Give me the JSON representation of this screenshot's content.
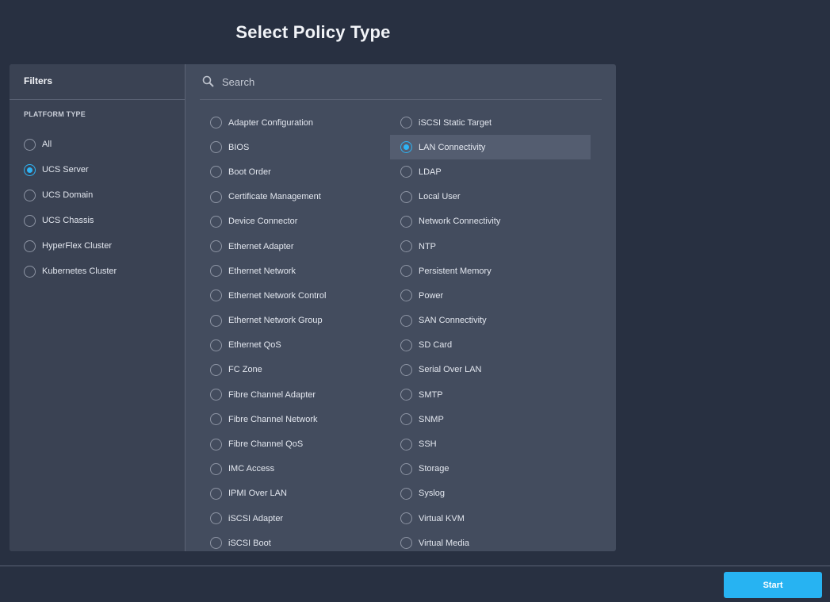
{
  "page": {
    "title": "Select Policy Type"
  },
  "filters": {
    "header": "Filters",
    "section_title": "PLATFORM TYPE",
    "selected": "UCS Server",
    "items": [
      {
        "label": "All",
        "checked": false
      },
      {
        "label": "UCS Server",
        "checked": true
      },
      {
        "label": "UCS Domain",
        "checked": false
      },
      {
        "label": "UCS Chassis",
        "checked": false
      },
      {
        "label": "HyperFlex Cluster",
        "checked": false
      },
      {
        "label": "Kubernetes Cluster",
        "checked": false
      }
    ]
  },
  "search": {
    "placeholder": "Search",
    "value": ""
  },
  "policies": {
    "selected": "LAN Connectivity",
    "left_column": [
      "Adapter Configuration",
      "BIOS",
      "Boot Order",
      "Certificate Management",
      "Device Connector",
      "Ethernet Adapter",
      "Ethernet Network",
      "Ethernet Network Control",
      "Ethernet Network Group",
      "Ethernet QoS",
      "FC Zone",
      "Fibre Channel Adapter",
      "Fibre Channel Network",
      "Fibre Channel QoS",
      "IMC Access",
      "IPMI Over LAN",
      "iSCSI Adapter",
      "iSCSI Boot"
    ],
    "right_column": [
      "iSCSI Static Target",
      "LAN Connectivity",
      "LDAP",
      "Local User",
      "Network Connectivity",
      "NTP",
      "Persistent Memory",
      "Power",
      "SAN Connectivity",
      "SD Card",
      "Serial Over LAN",
      "SMTP",
      "SNMP",
      "SSH",
      "Storage",
      "Syslog",
      "Virtual KVM",
      "Virtual Media"
    ]
  },
  "footer": {
    "start_label": "Start"
  },
  "colors": {
    "background": "#283041",
    "panel": "#434c5e",
    "accent": "#27b3f2",
    "selected_row": "#545d70"
  },
  "icons": {
    "search": "search-icon"
  }
}
